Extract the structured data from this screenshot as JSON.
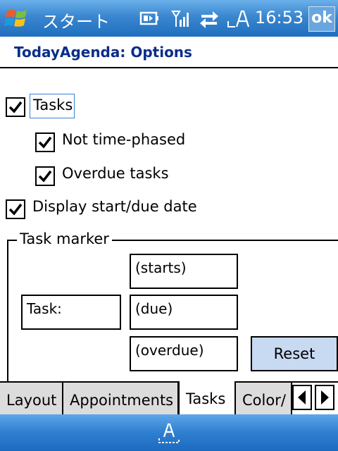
{
  "titlebar": {
    "start_label": "スタート",
    "time": "16:53",
    "ok_label": "ok",
    "icons": [
      "windows-flag-icon",
      "battery-icon",
      "signal-icon",
      "sync-arrows-icon",
      "input-A-icon"
    ]
  },
  "app": {
    "title": "TodayAgenda: Options"
  },
  "options": {
    "tasks": {
      "label": "Tasks",
      "checked": true
    },
    "not_time_phased": {
      "label": "Not time-phased",
      "checked": true
    },
    "overdue_tasks": {
      "label": "Overdue tasks",
      "checked": true
    },
    "display_dates": {
      "label": "Display start/due date",
      "checked": true
    }
  },
  "task_marker": {
    "title": "Task marker",
    "task_field": "Task:",
    "starts_field": "(starts)",
    "due_field": "(due)",
    "overdue_field": "(overdue)",
    "reset_label": "Reset"
  },
  "tabs": [
    {
      "label": "Layout",
      "active": false
    },
    {
      "label": "Appointments",
      "active": false
    },
    {
      "label": "Tasks",
      "active": true
    },
    {
      "label": "Color/",
      "active": false
    }
  ],
  "bottombar": {
    "sip_icon": "A"
  },
  "colors": {
    "titlebar": "#3a86cf",
    "app_title": "#0a2d8a",
    "reset_button": "#c7daf2"
  }
}
